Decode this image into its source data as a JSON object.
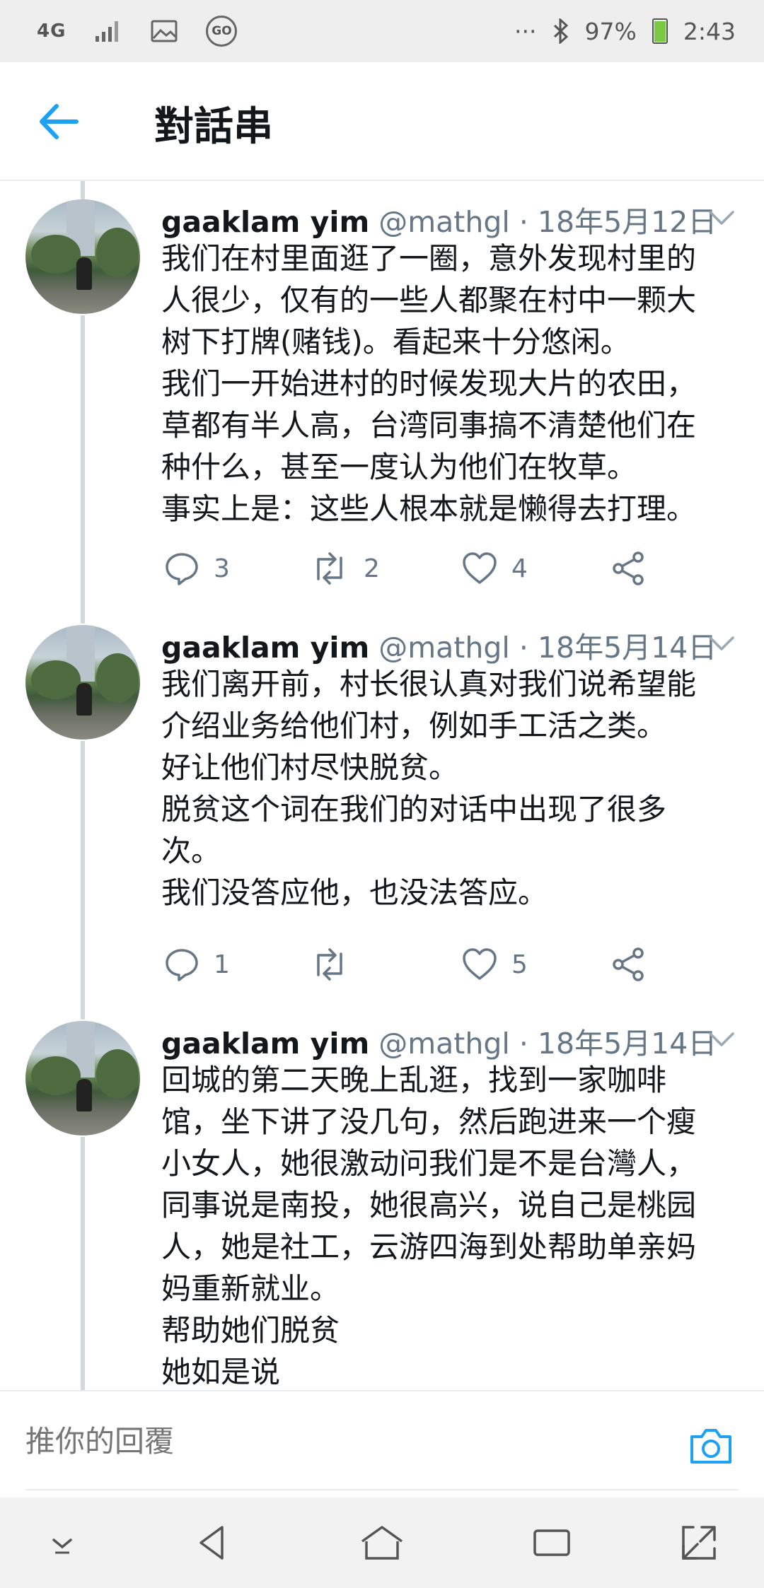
{
  "status_bar": {
    "network": "4G",
    "battery": "97%",
    "time": "2:43",
    "dots": "···",
    "go_badge": "GO"
  },
  "header": {
    "title": "對話串"
  },
  "tweets": [
    {
      "name": "gaaklam yim",
      "handle": "@mathgl",
      "dot": "·",
      "date": "18年5月12日",
      "lines": [
        "我们在村里面逛了一圈，意外发现村里的",
        "人很少，仅有的一些人都聚在村中一颗大",
        "树下打牌(赌钱)。看起来十分悠闲。",
        "我们一开始进村的时候发现大片的农田，",
        "草都有半人高，台湾同事搞不清楚他们在",
        "种什么，甚至一度认为他们在牧草。",
        "事实上是：这些人根本就是懒得去打理。"
      ],
      "replies": "3",
      "retweets": "2",
      "likes": "4"
    },
    {
      "name": "gaaklam yim",
      "handle": "@mathgl",
      "dot": "·",
      "date": "18年5月14日",
      "lines": [
        "我们离开前，村长很认真对我们说希望能",
        "介绍业务给他们村，例如手工活之类。",
        "好让他们村尽快脱贫。",
        "脱贫这个词在我们的对话中出现了很多",
        "次。",
        "我们没答应他，也没法答应。"
      ],
      "replies": "1",
      "retweets": "",
      "likes": "5"
    },
    {
      "name": "gaaklam yim",
      "handle": "@mathgl",
      "dot": "·",
      "date": "18年5月14日",
      "lines": [
        "回城的第二天晚上乱逛，找到一家咖啡",
        "馆，坐下讲了没几句，然后跑进来一个瘦",
        "小女人，她很激动问我们是不是台灣人，",
        "同事说是南投，她很高兴，说自己是桃园",
        "人，她是社工，云游四海到处帮助单亲妈",
        "妈重新就业。",
        "帮助她们脱贫",
        "她如是说"
      ]
    }
  ],
  "reply_bar": {
    "placeholder": "推你的回覆"
  },
  "colors": {
    "accent": "#1da1f2",
    "muted": "#657786",
    "text": "#14171a"
  }
}
